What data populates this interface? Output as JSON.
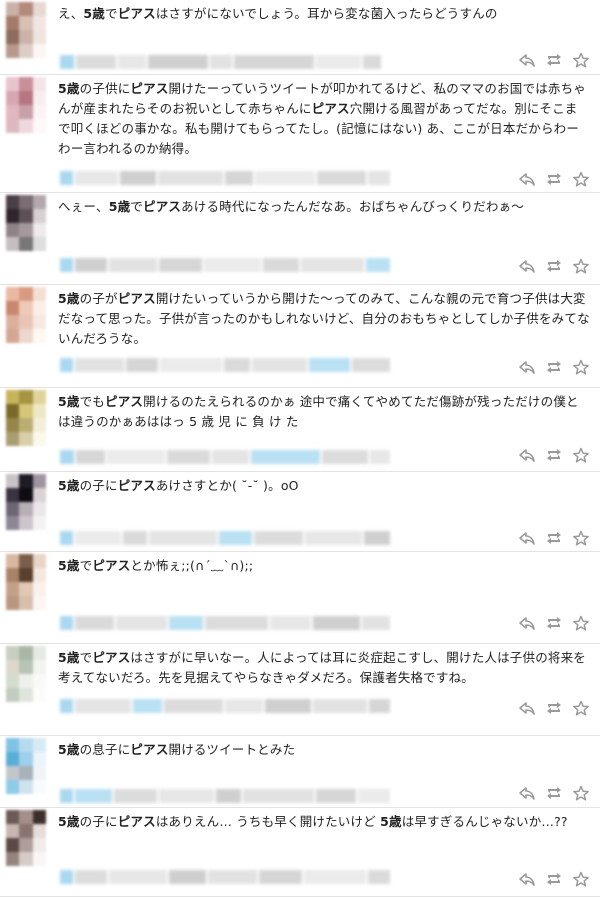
{
  "tweets": [
    {
      "segments": [
        {
          "t": "え、",
          "b": false
        },
        {
          "t": "5歳",
          "b": true
        },
        {
          "t": "で",
          "b": false
        },
        {
          "t": "ピアス",
          "b": true
        },
        {
          "t": "はさすがにないでしょう。耳から変な菌入ったらどうすんの",
          "b": false
        }
      ]
    },
    {
      "segments": [
        {
          "t": "5歳",
          "b": true
        },
        {
          "t": "の子供に",
          "b": false
        },
        {
          "t": "ピアス",
          "b": true
        },
        {
          "t": "開けたーっていうツイートが叩かれてるけど、私のママのお国では赤ちゃんが産まれたらそのお祝いとして赤ちゃんに",
          "b": false
        },
        {
          "t": "ピアス",
          "b": true
        },
        {
          "t": "穴開ける風習があってだな。別にそこまで叩くほどの事かな。私も開けてもらってたし。(記憶にはない) あ、ここが日本だからわーわー言われるのか納得。",
          "b": false
        }
      ]
    },
    {
      "segments": [
        {
          "t": "へぇー、",
          "b": false
        },
        {
          "t": "5歳",
          "b": true
        },
        {
          "t": "で",
          "b": false
        },
        {
          "t": "ピアス",
          "b": true
        },
        {
          "t": "あける時代になったんだなあ。おばちゃんびっくりだわぁ〜",
          "b": false
        }
      ]
    },
    {
      "segments": [
        {
          "t": "5歳",
          "b": true
        },
        {
          "t": "の子が",
          "b": false
        },
        {
          "t": "ピアス",
          "b": true
        },
        {
          "t": "開けたいっていうから開けた〜ってのみて、こんな親の元で育つ子供は大変だなって思った。子供が言ったのかもしれないけど、自分のおもちゃとしてしか子供をみてないんだろうな。",
          "b": false
        }
      ]
    },
    {
      "segments": [
        {
          "t": "5歳",
          "b": true
        },
        {
          "t": "でも",
          "b": false
        },
        {
          "t": "ピアス",
          "b": true
        },
        {
          "t": "開けるのたえられるのかぁ 途中で痛くてやめてただ傷跡が残っただけの僕とは違うのかぁあははっ 5 歳 児 に 負 け た",
          "b": false
        }
      ]
    },
    {
      "segments": [
        {
          "t": "5歳",
          "b": true
        },
        {
          "t": "の子に",
          "b": false
        },
        {
          "t": "ピアス",
          "b": true
        },
        {
          "t": "あけさすとか( ˘-˘ )。oO",
          "b": false
        }
      ]
    },
    {
      "segments": [
        {
          "t": "5歳",
          "b": true
        },
        {
          "t": "で",
          "b": false
        },
        {
          "t": "ピアス",
          "b": true
        },
        {
          "t": "とか怖ぇ;;(∩´﹏`∩);;",
          "b": false
        }
      ]
    },
    {
      "segments": [
        {
          "t": "5歳",
          "b": true
        },
        {
          "t": "で",
          "b": false
        },
        {
          "t": "ピアス",
          "b": true
        },
        {
          "t": "はさすがに早いなー。人によっては耳に炎症起こすし、開けた人は子供の将来を考えてないだろ。先を見据えてやらなきゃダメだろ。保護者失格ですね。",
          "b": false
        }
      ]
    },
    {
      "segments": [
        {
          "t": "5歳",
          "b": true
        },
        {
          "t": "の息子に",
          "b": false
        },
        {
          "t": "ピアス",
          "b": true
        },
        {
          "t": "開けるツイートとみた",
          "b": false
        }
      ]
    },
    {
      "segments": [
        {
          "t": "5歳",
          "b": true
        },
        {
          "t": "の子に",
          "b": false
        },
        {
          "t": "ピアス",
          "b": true
        },
        {
          "t": "はありえん… うちも早く開けたいけど ",
          "b": false
        },
        {
          "t": "5歳",
          "b": true
        },
        {
          "t": "は早すぎるんじゃないか…??",
          "b": false
        }
      ]
    }
  ],
  "icons": [
    "reply-icon",
    "retweet-icon",
    "favorite-icon"
  ],
  "colors": {
    "accent": "#a9d8f0",
    "icon": "#9a9a9a",
    "divider": "#e3e3e3"
  }
}
